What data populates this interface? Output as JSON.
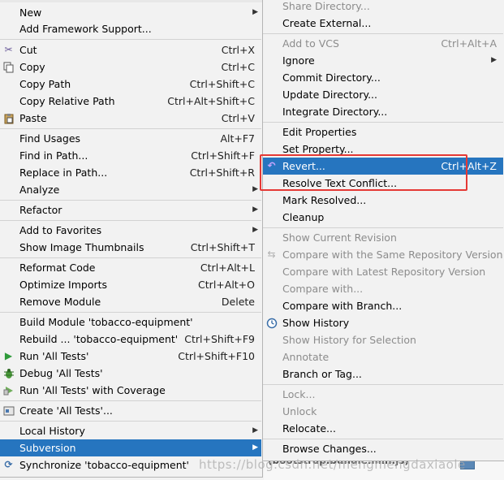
{
  "top_cut_text": "",
  "left_menu": {
    "items": [
      {
        "label": "New",
        "arrow": true
      },
      {
        "label": "Add Framework Support..."
      },
      {
        "label": "Cut",
        "shortcut": "Ctrl+X",
        "icon": "scissors-icon"
      },
      {
        "label": "Copy",
        "shortcut": "Ctrl+C",
        "icon": "copy-icon"
      },
      {
        "label": "Copy Path",
        "shortcut": "Ctrl+Shift+C"
      },
      {
        "label": "Copy Relative Path",
        "shortcut": "Ctrl+Alt+Shift+C"
      },
      {
        "label": "Paste",
        "shortcut": "Ctrl+V",
        "icon": "clipboard-icon"
      },
      {
        "label": "Find Usages",
        "shortcut": "Alt+F7"
      },
      {
        "label": "Find in Path...",
        "shortcut": "Ctrl+Shift+F"
      },
      {
        "label": "Replace in Path...",
        "shortcut": "Ctrl+Shift+R"
      },
      {
        "label": "Analyze",
        "arrow": true
      },
      {
        "label": "Refactor",
        "arrow": true
      },
      {
        "label": "Add to Favorites",
        "arrow": true
      },
      {
        "label": "Show Image Thumbnails",
        "shortcut": "Ctrl+Shift+T"
      },
      {
        "label": "Reformat Code",
        "shortcut": "Ctrl+Alt+L"
      },
      {
        "label": "Optimize Imports",
        "shortcut": "Ctrl+Alt+O"
      },
      {
        "label": "Remove Module",
        "shortcut": "Delete"
      },
      {
        "label": "Build Module 'tobacco-equipment'"
      },
      {
        "label": "Rebuild ... 'tobacco-equipment'",
        "shortcut": "Ctrl+Shift+F9"
      },
      {
        "label": "Run 'All Tests'",
        "shortcut": "Ctrl+Shift+F10",
        "icon": "run-icon"
      },
      {
        "label": "Debug 'All Tests'",
        "icon": "debug-icon"
      },
      {
        "label": "Run 'All Tests' with Coverage",
        "icon": "coverage-icon"
      },
      {
        "label": "Create 'All Tests'...",
        "icon": "create-config-icon"
      },
      {
        "label": "Local History",
        "arrow": true
      },
      {
        "label": "Subversion",
        "arrow": true,
        "selected": true
      },
      {
        "label": "Synchronize 'tobacco-equipment'",
        "icon": "sync-icon"
      }
    ]
  },
  "right_menu": {
    "items": [
      {
        "label": "Share Directory...",
        "disabled": true
      },
      {
        "label": "Create External..."
      },
      {
        "label": "Add to VCS",
        "shortcut": "Ctrl+Alt+A",
        "disabled": true
      },
      {
        "label": "Ignore",
        "arrow": true
      },
      {
        "label": "Commit Directory..."
      },
      {
        "label": "Update Directory..."
      },
      {
        "label": "Integrate Directory..."
      },
      {
        "label": "Edit Properties"
      },
      {
        "label": "Set Property..."
      },
      {
        "label": "Revert...",
        "shortcut": "Ctrl+Alt+Z",
        "selected": true,
        "icon": "revert-icon"
      },
      {
        "label": "Resolve Text Conflict..."
      },
      {
        "label": "Mark Resolved..."
      },
      {
        "label": "Cleanup"
      },
      {
        "label": "Show Current Revision",
        "disabled": true
      },
      {
        "label": "Compare with the Same Repository Version",
        "disabled": true,
        "icon": "compare-icon"
      },
      {
        "label": "Compare with Latest Repository Version",
        "disabled": true
      },
      {
        "label": "Compare with...",
        "disabled": true
      },
      {
        "label": "Compare with Branch..."
      },
      {
        "label": "Show History",
        "icon": "history-icon"
      },
      {
        "label": "Show History for Selection",
        "disabled": true
      },
      {
        "label": "Annotate",
        "disabled": true
      },
      {
        "label": "Branch or Tag..."
      },
      {
        "label": "Lock...",
        "disabled": true
      },
      {
        "label": "Unlock",
        "disabled": true
      },
      {
        "label": "Relocate..."
      },
      {
        "label": "Browse Changes..."
      }
    ]
  },
  "background": {
    "editor_text": "(bootstrap.bundle.min.js)",
    "watermark": "https://blog.csdn.net/mengmengdaxiaole"
  }
}
